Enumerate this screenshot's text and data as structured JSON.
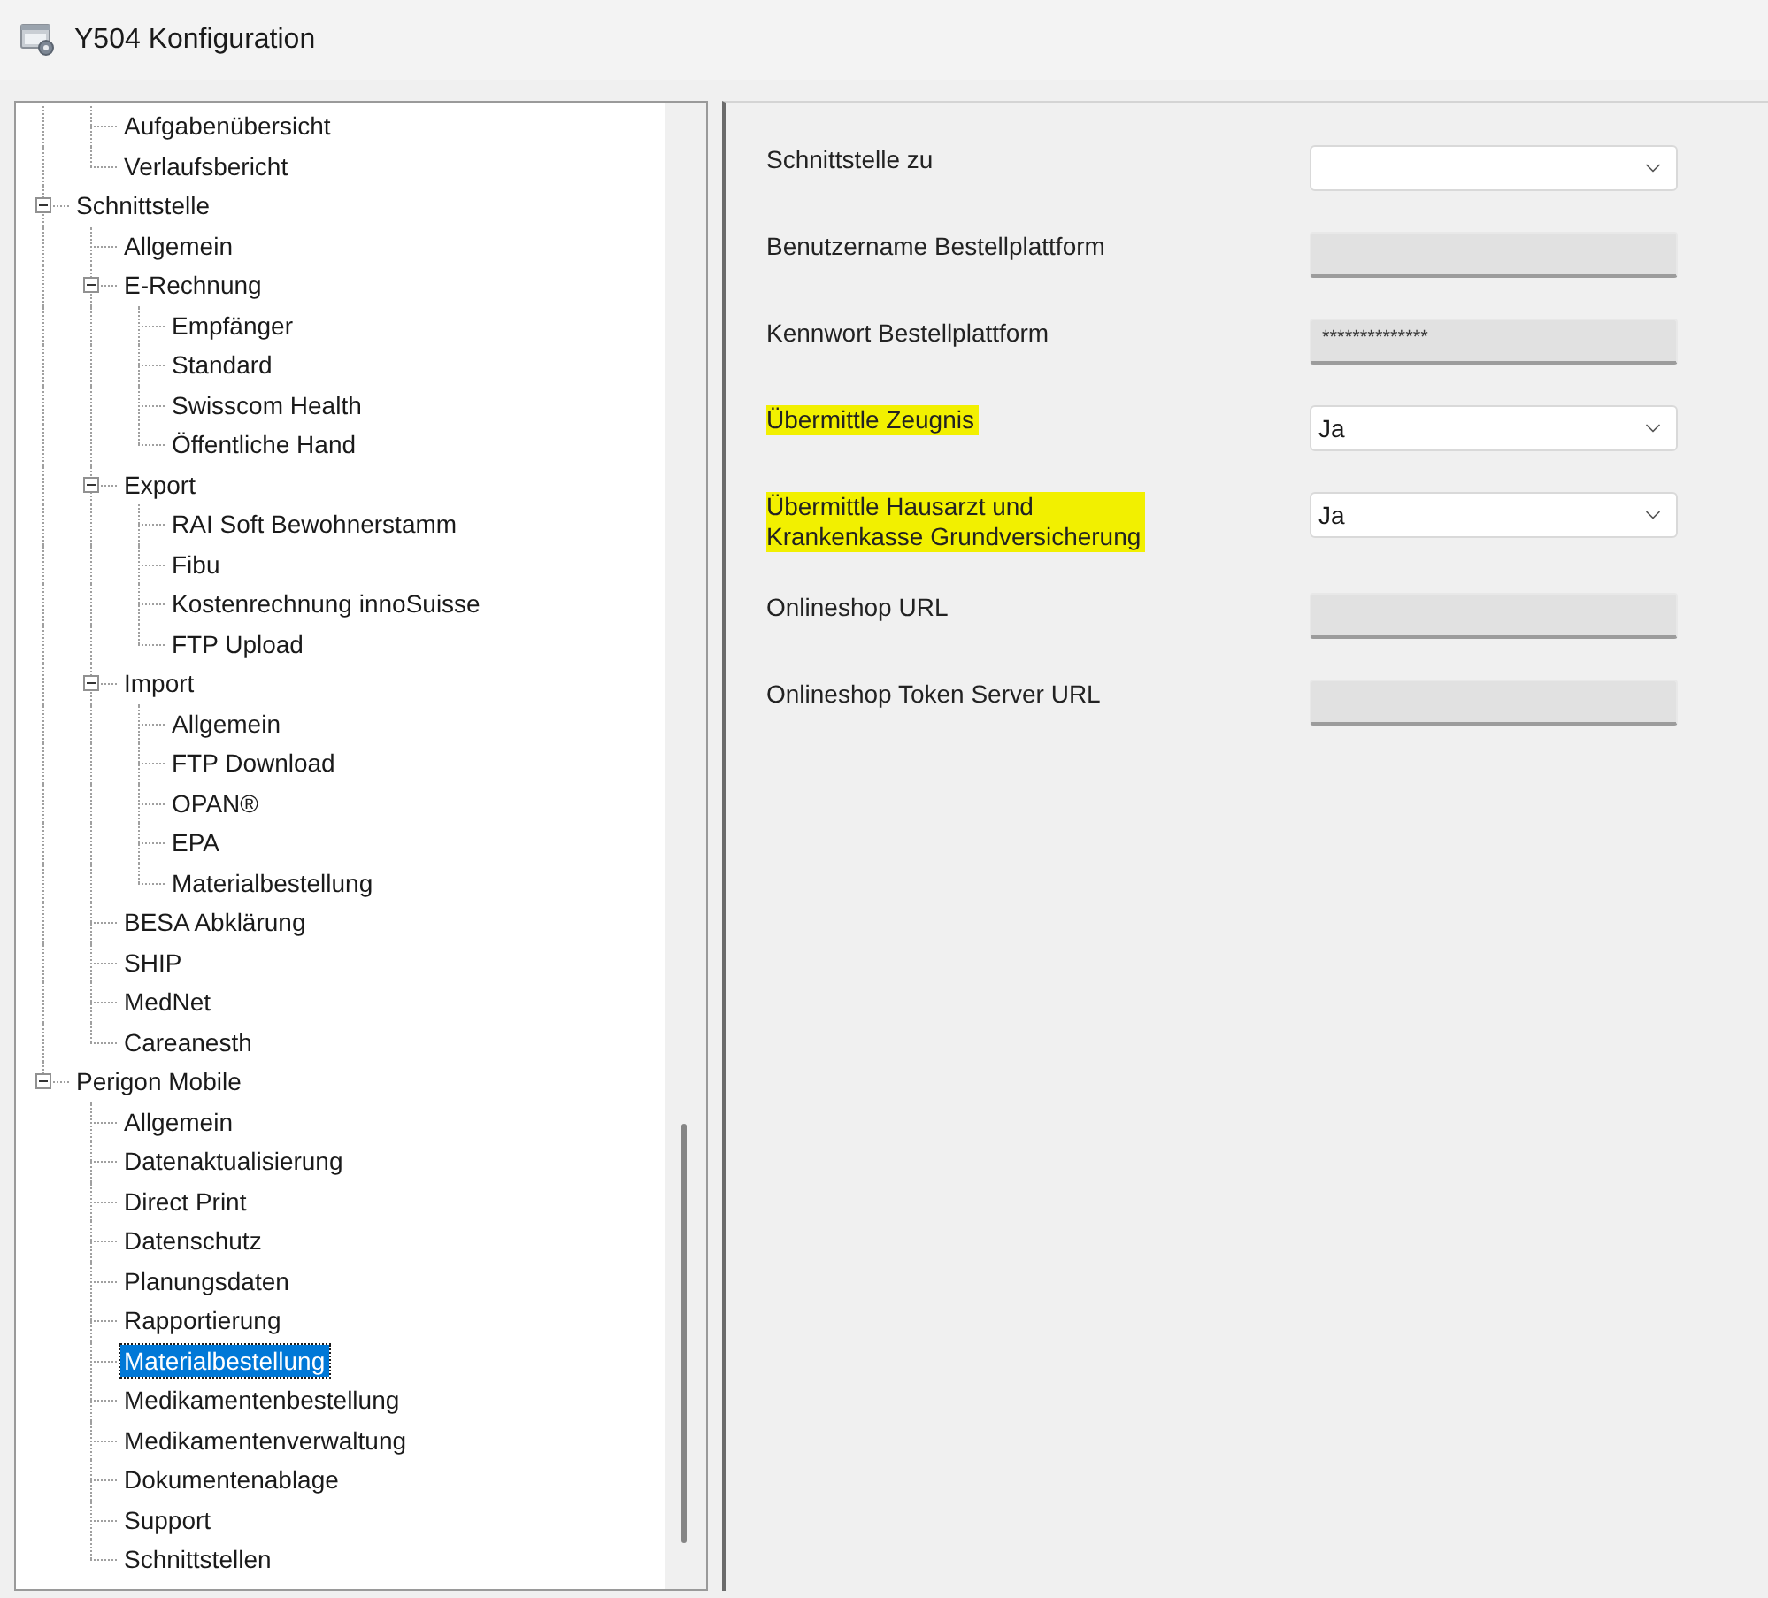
{
  "window": {
    "title": "Y504 Konfiguration"
  },
  "tree": {
    "partial_branch": {
      "children": [
        {
          "label": "Aufgabenübersicht",
          "selected": false
        },
        {
          "label": "Verlaufsbericht",
          "selected": false
        }
      ]
    },
    "items": [
      {
        "label": "Schnittstelle",
        "expanded": true,
        "selected": false,
        "children": [
          {
            "label": "Allgemein",
            "selected": false
          },
          {
            "label": "E-Rechnung",
            "expanded": true,
            "selected": false,
            "children": [
              {
                "label": "Empfänger",
                "selected": false
              },
              {
                "label": "Standard",
                "selected": false
              },
              {
                "label": "Swisscom Health",
                "selected": false
              },
              {
                "label": "Öffentliche Hand",
                "selected": false
              }
            ]
          },
          {
            "label": "Export",
            "expanded": true,
            "selected": false,
            "children": [
              {
                "label": "RAI Soft Bewohnerstamm",
                "selected": false
              },
              {
                "label": "Fibu",
                "selected": false
              },
              {
                "label": "Kostenrechnung innoSuisse",
                "selected": false
              },
              {
                "label": "FTP Upload",
                "selected": false
              }
            ]
          },
          {
            "label": "Import",
            "expanded": true,
            "selected": false,
            "children": [
              {
                "label": "Allgemein",
                "selected": false
              },
              {
                "label": "FTP Download",
                "selected": false
              },
              {
                "label": "OPAN®",
                "selected": false
              },
              {
                "label": "EPA",
                "selected": false
              },
              {
                "label": "Materialbestellung",
                "selected": false
              }
            ]
          },
          {
            "label": "BESA Abklärung",
            "selected": false
          },
          {
            "label": "SHIP",
            "selected": false
          },
          {
            "label": "MedNet",
            "selected": false
          },
          {
            "label": "Careanesth",
            "selected": false
          }
        ]
      },
      {
        "label": "Perigon Mobile",
        "expanded": true,
        "selected": false,
        "children": [
          {
            "label": "Allgemein",
            "selected": false
          },
          {
            "label": "Datenaktualisierung",
            "selected": false
          },
          {
            "label": "Direct Print",
            "selected": false
          },
          {
            "label": "Datenschutz",
            "selected": false
          },
          {
            "label": "Planungsdaten",
            "selected": false
          },
          {
            "label": "Rapportierung",
            "selected": false
          },
          {
            "label": "Materialbestellung",
            "selected": true
          },
          {
            "label": "Medikamentenbestellung",
            "selected": false
          },
          {
            "label": "Medikamentenverwaltung",
            "selected": false
          },
          {
            "label": "Dokumentenablage",
            "selected": false
          },
          {
            "label": "Support",
            "selected": false
          },
          {
            "label": "Schnittstellen",
            "selected": false
          }
        ]
      }
    ]
  },
  "form": {
    "fields": [
      {
        "label": "Schnittstelle zu",
        "kind": "dropdown",
        "disabled": false,
        "highlighted": false
      },
      {
        "label": "Benutzername Bestellplattform",
        "kind": "textbox",
        "disabled": true,
        "highlighted": false
      },
      {
        "label": "Kennwort Bestellplattform",
        "kind": "textbox",
        "value": "**************",
        "disabled": true,
        "highlighted": false
      },
      {
        "label": "Übermittle Zeugnis",
        "kind": "dropdown",
        "value": "Ja",
        "disabled": false,
        "highlighted": true
      },
      {
        "label": "Übermittle Hausarzt und\nKrankenkasse Grundversicherung",
        "kind": "dropdown",
        "value": "Ja",
        "disabled": false,
        "highlighted": true
      },
      {
        "label": "Onlineshop URL",
        "kind": "textbox",
        "disabled": true,
        "highlighted": false
      },
      {
        "label": "Onlineshop Token Server URL",
        "kind": "textbox",
        "disabled": true,
        "highlighted": false
      }
    ]
  }
}
